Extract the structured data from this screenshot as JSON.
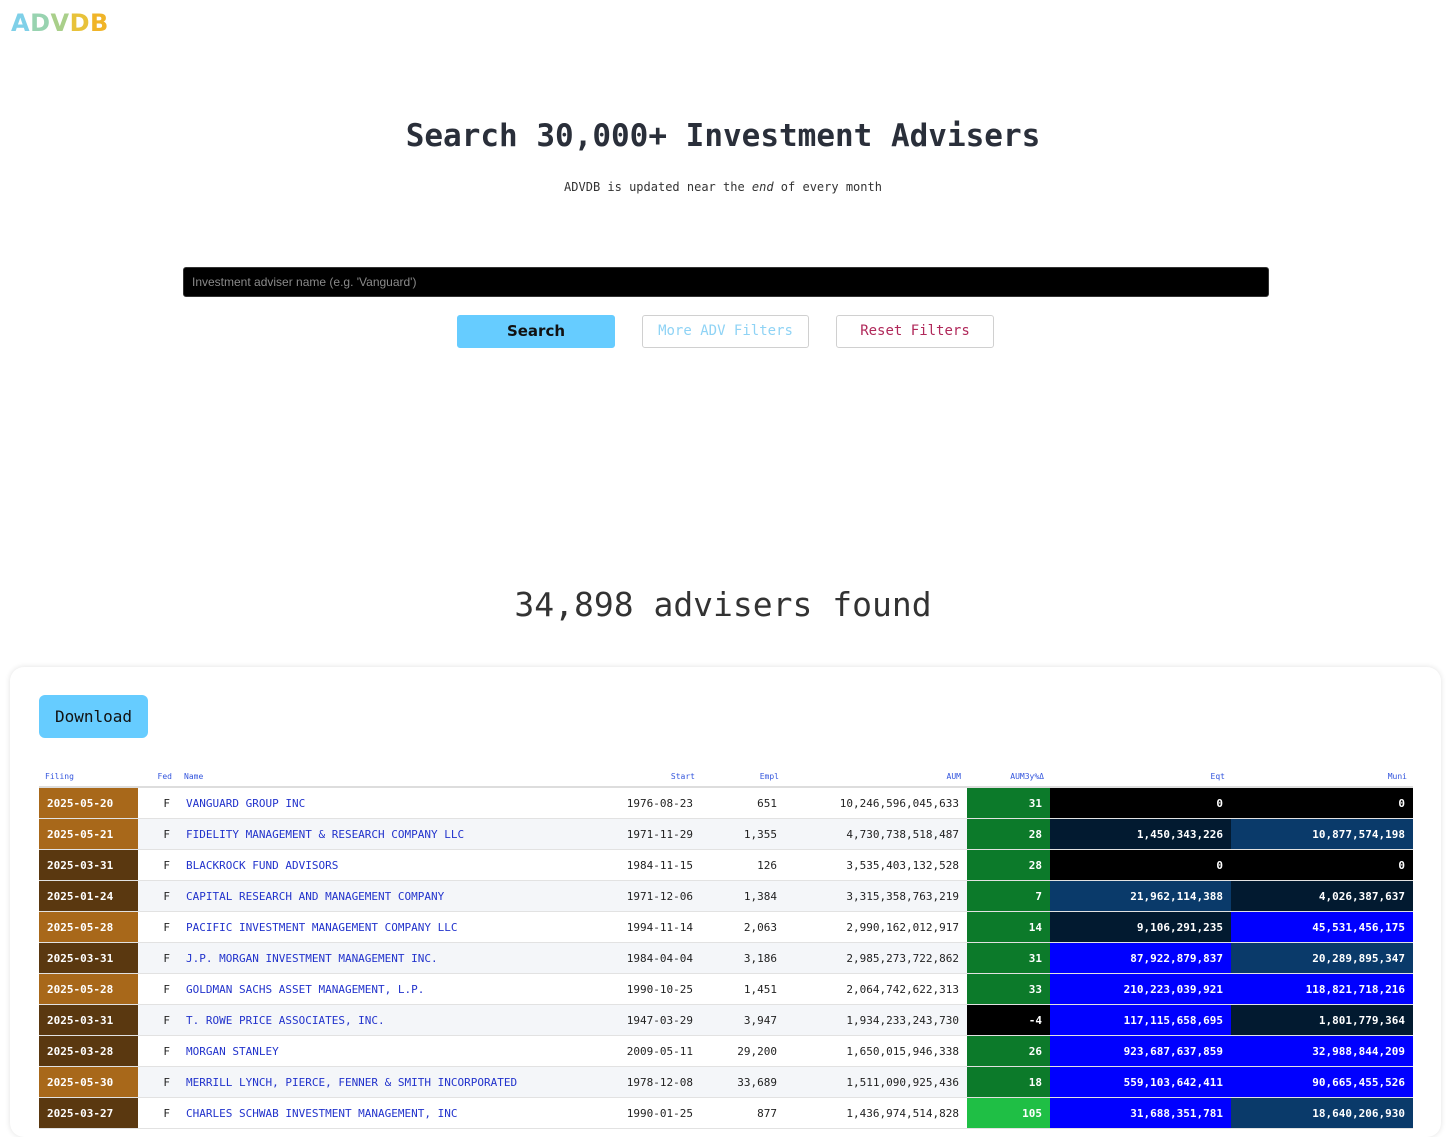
{
  "brand": {
    "letters": [
      {
        "char": "A",
        "color": "#7fd0e8"
      },
      {
        "char": "D",
        "color": "#98d3b0"
      },
      {
        "char": "V",
        "color": "#a9cf8a"
      },
      {
        "char": "D",
        "color": "#e8c23a"
      },
      {
        "char": "B",
        "color": "#f0b428"
      }
    ]
  },
  "hero": {
    "title": "Search 30,000+ Investment Advisers",
    "subtitle_pre": "ADVDB is updated near the ",
    "subtitle_em": "end",
    "subtitle_post": " of every month"
  },
  "search": {
    "placeholder": "Investment adviser name (e.g. 'Vanguard')",
    "value": "",
    "search_label": "Search",
    "more_filters_label": "More ADV Filters",
    "reset_label": "Reset Filters"
  },
  "results": {
    "count_text": "34,898 advisers found",
    "download_label": "Download",
    "columns": [
      "Filing",
      "Fed",
      "Name",
      "Start",
      "Empl",
      "AUM",
      "AUM3y%Δ",
      "Eqt",
      "Muni"
    ],
    "rows": [
      {
        "filing": "2025-05-20",
        "filing_color": "#a8681a",
        "fed": "F",
        "name": "VANGUARD GROUP INC",
        "start": "1976-08-23",
        "empl": "651",
        "aum": "10,246,596,045,633",
        "aum3y": "31",
        "aum3y_color": "#0c7a2a",
        "eqt": "0",
        "eqt_color": "#000000",
        "muni": "0",
        "muni_color": "#000000"
      },
      {
        "filing": "2025-05-21",
        "filing_color": "#a8681a",
        "fed": "F",
        "name": "FIDELITY MANAGEMENT & RESEARCH COMPANY LLC",
        "start": "1971-11-29",
        "empl": "1,355",
        "aum": "4,730,738,518,487",
        "aum3y": "28",
        "aum3y_color": "#0c7a2a",
        "eqt": "1,450,343,226",
        "eqt_color": "#021a30",
        "muni": "10,877,574,198",
        "muni_color": "#0a3a6a"
      },
      {
        "filing": "2025-03-31",
        "filing_color": "#5a3810",
        "fed": "F",
        "name": "BLACKROCK FUND ADVISORS",
        "start": "1984-11-15",
        "empl": "126",
        "aum": "3,535,403,132,528",
        "aum3y": "28",
        "aum3y_color": "#0c7a2a",
        "eqt": "0",
        "eqt_color": "#000000",
        "muni": "0",
        "muni_color": "#000000"
      },
      {
        "filing": "2025-01-24",
        "filing_color": "#5a3810",
        "fed": "F",
        "name": "CAPITAL RESEARCH AND MANAGEMENT COMPANY",
        "start": "1971-12-06",
        "empl": "1,384",
        "aum": "3,315,358,763,219",
        "aum3y": "7",
        "aum3y_color": "#0c7a2a",
        "eqt": "21,962,114,388",
        "eqt_color": "#0a3a6a",
        "muni": "4,026,387,637",
        "muni_color": "#021a30"
      },
      {
        "filing": "2025-05-28",
        "filing_color": "#a8681a",
        "fed": "F",
        "name": "PACIFIC INVESTMENT MANAGEMENT COMPANY LLC",
        "start": "1994-11-14",
        "empl": "2,063",
        "aum": "2,990,162,012,917",
        "aum3y": "14",
        "aum3y_color": "#0c7a2a",
        "eqt": "9,106,291,235",
        "eqt_color": "#021a30",
        "muni": "45,531,456,175",
        "muni_color": "#0000ff"
      },
      {
        "filing": "2025-03-31",
        "filing_color": "#5a3810",
        "fed": "F",
        "name": "J.P. MORGAN INVESTMENT MANAGEMENT INC.",
        "start": "1984-04-04",
        "empl": "3,186",
        "aum": "2,985,273,722,862",
        "aum3y": "31",
        "aum3y_color": "#0c7a2a",
        "eqt": "87,922,879,837",
        "eqt_color": "#0000ff",
        "muni": "20,289,895,347",
        "muni_color": "#0a3a6a"
      },
      {
        "filing": "2025-05-28",
        "filing_color": "#a8681a",
        "fed": "F",
        "name": "GOLDMAN SACHS ASSET MANAGEMENT, L.P.",
        "start": "1990-10-25",
        "empl": "1,451",
        "aum": "2,064,742,622,313",
        "aum3y": "33",
        "aum3y_color": "#0c7a2a",
        "eqt": "210,223,039,921",
        "eqt_color": "#0000ff",
        "muni": "118,821,718,216",
        "muni_color": "#0000ff"
      },
      {
        "filing": "2025-03-31",
        "filing_color": "#5a3810",
        "fed": "F",
        "name": "T. ROWE PRICE ASSOCIATES, INC.",
        "start": "1947-03-29",
        "empl": "3,947",
        "aum": "1,934,233,243,730",
        "aum3y": "-4",
        "aum3y_color": "#000000",
        "eqt": "117,115,658,695",
        "eqt_color": "#0000ff",
        "muni": "1,801,779,364",
        "muni_color": "#021a30"
      },
      {
        "filing": "2025-03-28",
        "filing_color": "#5a3810",
        "fed": "F",
        "name": "MORGAN STANLEY",
        "start": "2009-05-11",
        "empl": "29,200",
        "aum": "1,650,015,946,338",
        "aum3y": "26",
        "aum3y_color": "#0c7a2a",
        "eqt": "923,687,637,859",
        "eqt_color": "#0000ff",
        "muni": "32,988,844,209",
        "muni_color": "#0000ff"
      },
      {
        "filing": "2025-05-30",
        "filing_color": "#a8681a",
        "fed": "F",
        "name": "MERRILL LYNCH, PIERCE, FENNER & SMITH INCORPORATED",
        "start": "1978-12-08",
        "empl": "33,689",
        "aum": "1,511,090,925,436",
        "aum3y": "18",
        "aum3y_color": "#0c7a2a",
        "eqt": "559,103,642,411",
        "eqt_color": "#0000ff",
        "muni": "90,665,455,526",
        "muni_color": "#0000ff"
      },
      {
        "filing": "2025-03-27",
        "filing_color": "#5a3810",
        "fed": "F",
        "name": "CHARLES SCHWAB INVESTMENT MANAGEMENT, INC",
        "start": "1990-01-25",
        "empl": "877",
        "aum": "1,436,974,514,828",
        "aum3y": "105",
        "aum3y_color": "#1fbf45",
        "eqt": "31,688,351,781",
        "eqt_color": "#0000ff",
        "muni": "18,640,206,930",
        "muni_color": "#0a3a6a"
      }
    ]
  }
}
